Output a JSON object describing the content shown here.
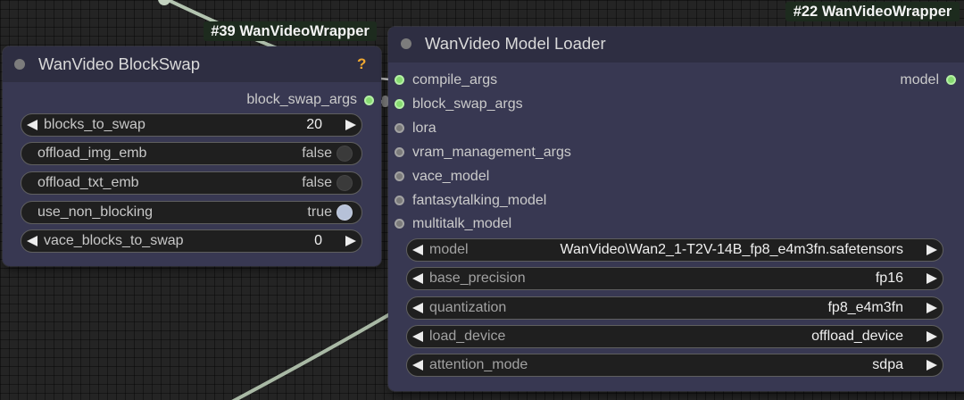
{
  "theme": {
    "canvas_bg": "#242424",
    "node_title_bg": "#2e2e42",
    "node_body_bg": "#383852",
    "widget_bg": "#1f1f1f",
    "slot_connected": "#86da71",
    "link": "#aebfab",
    "help_icon": "#f0a830",
    "badge_bg": "#1d2b1e",
    "toggle_on": "#b6c1d8"
  },
  "icons": {
    "node_collapse": "circle-dot-icon",
    "decrement": "triangle-left-icon",
    "increment": "triangle-right-icon",
    "toggle": "toggle-knob-icon"
  },
  "nodes": {
    "block_swap": {
      "badge": "#39 WanVideoWrapper",
      "title": "WanVideo BlockSwap",
      "help": "?",
      "outputs": [
        {
          "label": "block_swap_args",
          "connected": true
        }
      ],
      "widgets": [
        {
          "label": "blocks_to_swap",
          "value": "20"
        },
        {
          "label": "offload_img_emb",
          "value": "false"
        },
        {
          "label": "offload_txt_emb",
          "value": "false"
        },
        {
          "label": "use_non_blocking",
          "value": "true"
        },
        {
          "label": "vace_blocks_to_swap",
          "value": "0"
        }
      ]
    },
    "model_loader": {
      "badge": "#22 WanVideoWrapper",
      "title": "WanVideo Model Loader",
      "inputs": [
        {
          "label": "compile_args",
          "connected": true
        },
        {
          "label": "block_swap_args",
          "connected": true
        },
        {
          "label": "lora",
          "connected": false
        },
        {
          "label": "vram_management_args",
          "connected": false
        },
        {
          "label": "vace_model",
          "connected": false
        },
        {
          "label": "fantasytalking_model",
          "connected": false
        },
        {
          "label": "multitalk_model",
          "connected": false
        }
      ],
      "outputs": [
        {
          "label": "model",
          "connected": true
        }
      ],
      "widgets": [
        {
          "label": "model",
          "value": "WanVideo\\Wan2_1-T2V-14B_fp8_e4m3fn.safetensors"
        },
        {
          "label": "base_precision",
          "value": "fp16"
        },
        {
          "label": "quantization",
          "value": "fp8_e4m3fn"
        },
        {
          "label": "load_device",
          "value": "offload_device"
        },
        {
          "label": "attention_mode",
          "value": "sdpa"
        }
      ]
    }
  }
}
